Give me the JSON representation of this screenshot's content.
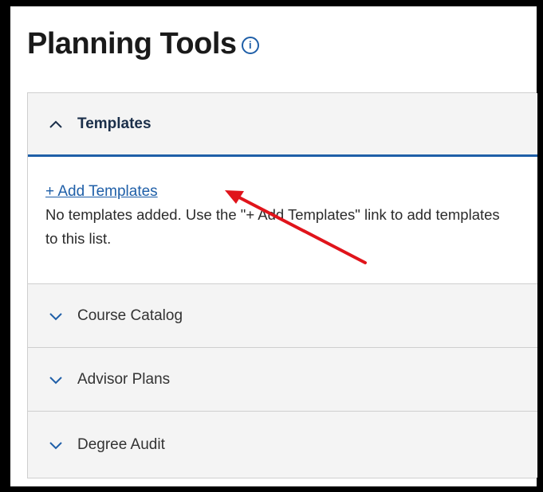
{
  "page": {
    "title": "Planning Tools",
    "info_icon": "info-circle-icon"
  },
  "accordion": {
    "templates": {
      "label": "Templates",
      "expanded": true,
      "add_link": "+ Add Templates",
      "empty_message": "No templates added. Use the \"+ Add Templates\" link to add templates to this list."
    },
    "course_catalog": {
      "label": "Course Catalog",
      "expanded": false
    },
    "advisor_plans": {
      "label": "Advisor Plans",
      "expanded": false
    },
    "degree_audit": {
      "label": "Degree Audit",
      "expanded": false
    }
  },
  "colors": {
    "accent": "#1f5fa8",
    "annotation_arrow": "#e0141b",
    "header_bg": "#f4f4f4",
    "border": "#cfcfcf"
  }
}
